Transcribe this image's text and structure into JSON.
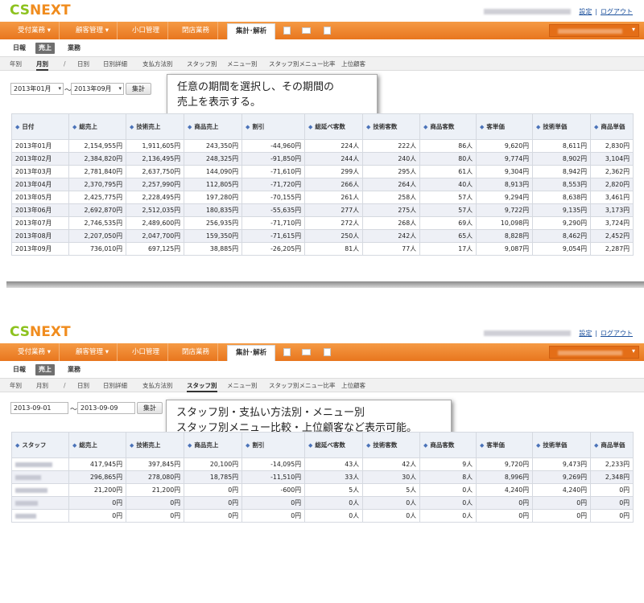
{
  "brand": {
    "cs": "CS",
    "nx": "NEXT"
  },
  "toplinks": {
    "settings": "設定",
    "logout": "ログアウト"
  },
  "nav": {
    "items": [
      {
        "label": "受付業務 ▾"
      },
      {
        "label": "顧客管理 ▾"
      },
      {
        "label": "小口管理"
      },
      {
        "label": "閉店業務"
      },
      {
        "label": "集計･解析"
      }
    ]
  },
  "subnav": [
    "日報",
    "売上",
    "業務"
  ],
  "tabs": [
    "年別",
    "月別",
    "/",
    "日別",
    "日別詳細",
    "支払方法別",
    "スタッフ別",
    "メニュー別",
    "スタッフ別メニュー比率",
    "上位顧客"
  ],
  "panel1": {
    "from_value": "2013年01月",
    "to_value": "2013年09月",
    "tilde": "〜",
    "button": "集計",
    "callout_line1": "任意の期間を選択し、その期間の",
    "callout_line2": "売上を表示する。",
    "table": {
      "headers": [
        "日付",
        "総売上",
        "技術売上",
        "商品売上",
        "割引",
        "総延べ客数",
        "技術客数",
        "商品客数",
        "客単価",
        "技術単価",
        "商品単価"
      ],
      "rows": [
        [
          "2013年01月",
          "2,154,955円",
          "1,911,605円",
          "243,350円",
          "-44,960円",
          "224人",
          "222人",
          "86人",
          "9,620円",
          "8,611円",
          "2,830円"
        ],
        [
          "2013年02月",
          "2,384,820円",
          "2,136,495円",
          "248,325円",
          "-91,850円",
          "244人",
          "240人",
          "80人",
          "9,774円",
          "8,902円",
          "3,104円"
        ],
        [
          "2013年03月",
          "2,781,840円",
          "2,637,750円",
          "144,090円",
          "-71,610円",
          "299人",
          "295人",
          "61人",
          "9,304円",
          "8,942円",
          "2,362円"
        ],
        [
          "2013年04月",
          "2,370,795円",
          "2,257,990円",
          "112,805円",
          "-71,720円",
          "266人",
          "264人",
          "40人",
          "8,913円",
          "8,553円",
          "2,820円"
        ],
        [
          "2013年05月",
          "2,425,775円",
          "2,228,495円",
          "197,280円",
          "-70,155円",
          "261人",
          "258人",
          "57人",
          "9,294円",
          "8,638円",
          "3,461円"
        ],
        [
          "2013年06月",
          "2,692,870円",
          "2,512,035円",
          "180,835円",
          "-55,635円",
          "277人",
          "275人",
          "57人",
          "9,722円",
          "9,135円",
          "3,173円"
        ],
        [
          "2013年07月",
          "2,746,535円",
          "2,489,600円",
          "256,935円",
          "-71,710円",
          "272人",
          "268人",
          "69人",
          "10,098円",
          "9,290円",
          "3,724円"
        ],
        [
          "2013年08月",
          "2,207,050円",
          "2,047,700円",
          "159,350円",
          "-71,615円",
          "250人",
          "242人",
          "65人",
          "8,828円",
          "8,462円",
          "2,452円"
        ],
        [
          "2013年09月",
          "736,010円",
          "697,125円",
          "38,885円",
          "-26,205円",
          "81人",
          "77人",
          "17人",
          "9,087円",
          "9,054円",
          "2,287円"
        ]
      ]
    }
  },
  "panel2": {
    "from_value": "2013-09-01",
    "to_value": "2013-09-09",
    "tilde": "〜",
    "button": "集計",
    "callout_line1": "スタッフ別・支払い方法別・メニュー別",
    "callout_line2": "スタッフ別メニュー比較・上位顧客など表示可能。",
    "table": {
      "headers": [
        "スタッフ",
        "総売上",
        "技術売上",
        "商品売上",
        "割引",
        "総延べ客数",
        "技術客数",
        "商品客数",
        "客単価",
        "技術単価",
        "商品単価"
      ],
      "rows": [
        [
          "",
          "417,945円",
          "397,845円",
          "20,100円",
          "-14,095円",
          "43人",
          "42人",
          "9人",
          "9,720円",
          "9,473円",
          "2,233円"
        ],
        [
          "",
          "296,865円",
          "278,080円",
          "18,785円",
          "-11,510円",
          "33人",
          "30人",
          "8人",
          "8,996円",
          "9,269円",
          "2,348円"
        ],
        [
          "",
          "21,200円",
          "21,200円",
          "0円",
          "-600円",
          "5人",
          "5人",
          "0人",
          "4,240円",
          "4,240円",
          "0円"
        ],
        [
          "",
          "0円",
          "0円",
          "0円",
          "0円",
          "0人",
          "0人",
          "0人",
          "0円",
          "0円",
          "0円"
        ],
        [
          "",
          "0円",
          "0円",
          "0円",
          "0円",
          "0人",
          "0人",
          "0人",
          "0円",
          "0円",
          "0円"
        ]
      ]
    }
  }
}
